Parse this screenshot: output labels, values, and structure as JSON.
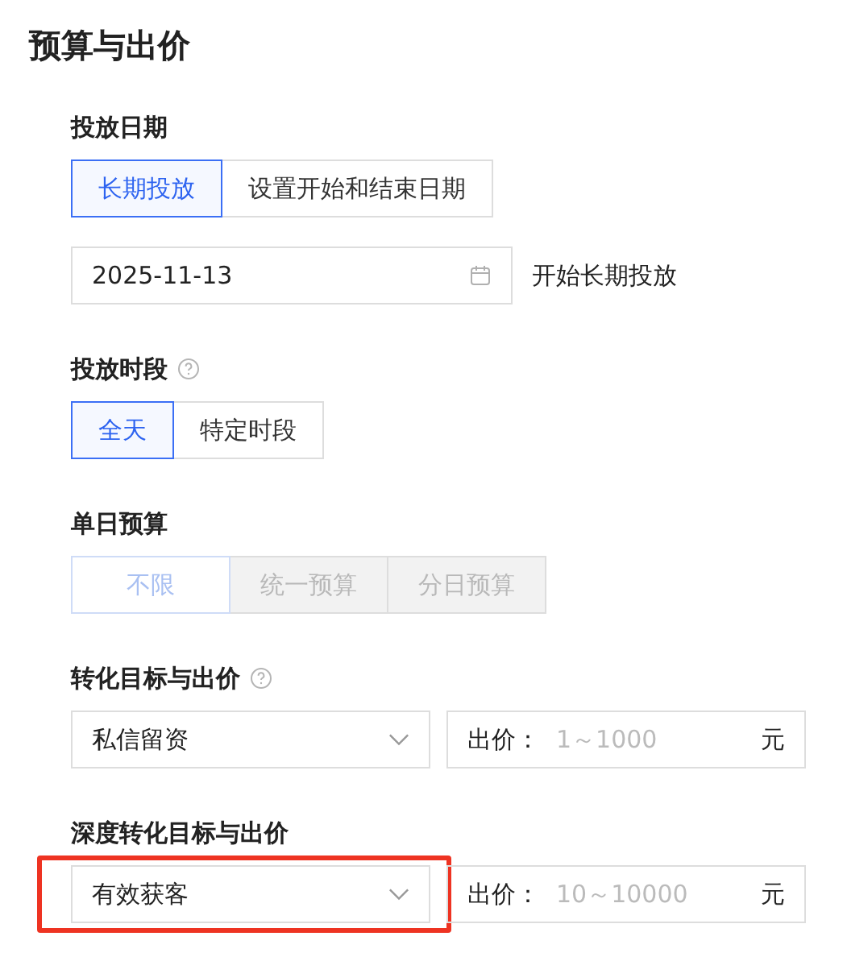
{
  "title": "预算与出价",
  "sections": [
    {
      "kind": "segmented",
      "label": "投放日期",
      "help": false,
      "options": [
        {
          "label": "长期投放",
          "selected": true,
          "disabled": false
        },
        {
          "label": "设置开始和结束日期",
          "selected": false,
          "disabled": false
        }
      ],
      "date": {
        "value": "2025-11-13",
        "note": "开始长期投放"
      }
    },
    {
      "kind": "segmented",
      "label": "投放时段",
      "help": true,
      "options": [
        {
          "label": "全天",
          "selected": true,
          "disabled": false
        },
        {
          "label": "特定时段",
          "selected": false,
          "disabled": false
        }
      ]
    },
    {
      "kind": "segmented",
      "label": "单日预算",
      "help": false,
      "options": [
        {
          "label": "不限",
          "selected": true,
          "disabled": true
        },
        {
          "label": "统一预算",
          "selected": false,
          "disabled": true
        },
        {
          "label": "分日预算",
          "selected": false,
          "disabled": true
        }
      ]
    },
    {
      "kind": "bid",
      "label": "转化目标与出价",
      "help": true,
      "select": "私信留资",
      "highlighted": false,
      "price_label": "出价：",
      "placeholder": "1～1000",
      "unit": "元"
    },
    {
      "kind": "bid",
      "label": "深度转化目标与出价",
      "help": false,
      "select": "有效获客",
      "highlighted": true,
      "price_label": "出价：",
      "placeholder": "10～10000",
      "unit": "元"
    }
  ]
}
